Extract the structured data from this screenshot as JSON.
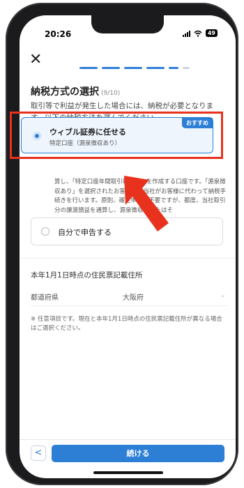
{
  "status_bar": {
    "time": "20:26",
    "battery": "49"
  },
  "header": {
    "close_glyph": "✕",
    "progress_segments": 5
  },
  "page": {
    "title": "納税方式の選択",
    "step": "(9/10)",
    "intro": "取引等で利益が発生した場合には、納税が必要となります。以下の納税方法を選んでください。"
  },
  "options": [
    {
      "label": "ウィブル証券に任せる",
      "sub": "特定口座（源泉徴収あり）",
      "badge": "おすすめ",
      "selected": true
    },
    {
      "label": "自分で申告する",
      "selected": false
    }
  ],
  "explanation": "算し、「特定口座年間取引報告書」を作成する口座です。「源泉徴収あり」を選択されたお客様は、当社がお客様に代わって納税手続きを行います。原則、確定申告は不要ですが、都度、当社取引分の譲渡損益を通算し、源泉徴収（またはそ",
  "address": {
    "section_title": "本年1月1日時点の住民票記載住所",
    "field_label": "都道府県",
    "field_value": "大阪府",
    "note": "※ 任意項目です。現在と本年1月1日時点の住民票記載住所が異なる場合はご選択ください。"
  },
  "footer": {
    "back_glyph": "<",
    "continue_label": "続ける"
  },
  "colors": {
    "accent": "#2d7fd6",
    "highlight": "#e8321d"
  },
  "icons": [
    "close-icon",
    "chevron-left-icon",
    "chevron-down-icon",
    "signal-icon",
    "wifi-icon",
    "battery-icon",
    "arrow-pointer-icon"
  ]
}
